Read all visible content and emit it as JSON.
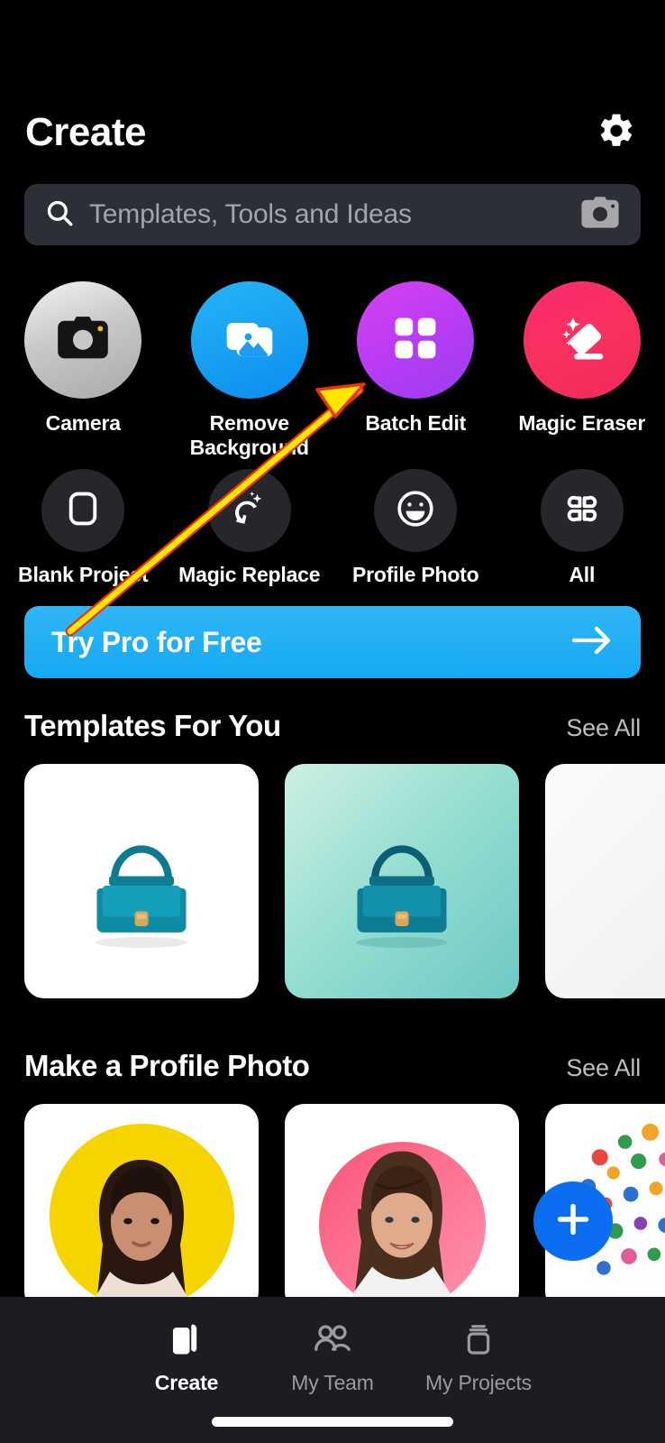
{
  "header": {
    "title": "Create",
    "settings_icon": "gear-icon"
  },
  "search": {
    "placeholder": "Templates, Tools and Ideas",
    "value": "",
    "search_icon": "search-icon",
    "camera_icon": "camera-icon"
  },
  "tools_row1": [
    {
      "label": "Camera",
      "icon": "camera-icon",
      "color": "#c8c8c8"
    },
    {
      "label": "Remove Background",
      "icon": "photos-stack-icon",
      "color": "#0a8df0"
    },
    {
      "label": "Batch Edit",
      "icon": "grid-four-squares-icon",
      "color": "#b63cf4"
    },
    {
      "label": "Magic Eraser",
      "icon": "magic-eraser-icon",
      "color": "#f9315f"
    }
  ],
  "tools_row2": [
    {
      "label": "Blank Project",
      "icon": "rounded-square-icon",
      "color": "#26262b"
    },
    {
      "label": "Magic Replace",
      "icon": "magic-replace-icon",
      "color": "#26262b"
    },
    {
      "label": "Profile Photo",
      "icon": "smiley-face-icon",
      "color": "#26262b"
    },
    {
      "label": "All",
      "icon": "clover-grid-icon",
      "color": "#26262b"
    }
  ],
  "promo": {
    "label": "Try Pro for Free",
    "arrow_icon": "arrow-right-icon",
    "color": "#16a9f2"
  },
  "sections": [
    {
      "title": "Templates For You",
      "see_all": "See All",
      "cards": [
        {
          "name": "handbag-white-background"
        },
        {
          "name": "handbag-mint-gradient-background"
        },
        {
          "name": "handbag-offwhite-background"
        }
      ]
    },
    {
      "title": "Make a Profile Photo",
      "see_all": "See All",
      "cards": [
        {
          "name": "profile-photo-yellow-circle"
        },
        {
          "name": "profile-photo-pink-circle"
        },
        {
          "name": "profile-photo-confetti-circle"
        }
      ]
    }
  ],
  "fab": {
    "icon": "plus-icon",
    "color": "#0b6ef0"
  },
  "bottom_nav": {
    "items": [
      {
        "label": "Create",
        "icon": "cards-stack-icon",
        "active": true
      },
      {
        "label": "My Team",
        "icon": "people-icon",
        "active": false
      },
      {
        "label": "My Projects",
        "icon": "projects-box-icon",
        "active": false
      }
    ]
  },
  "annotation": {
    "type": "arrow",
    "fill_color": "#ffe600",
    "stroke_color": "#e8340c",
    "points_to": "Batch Edit"
  }
}
